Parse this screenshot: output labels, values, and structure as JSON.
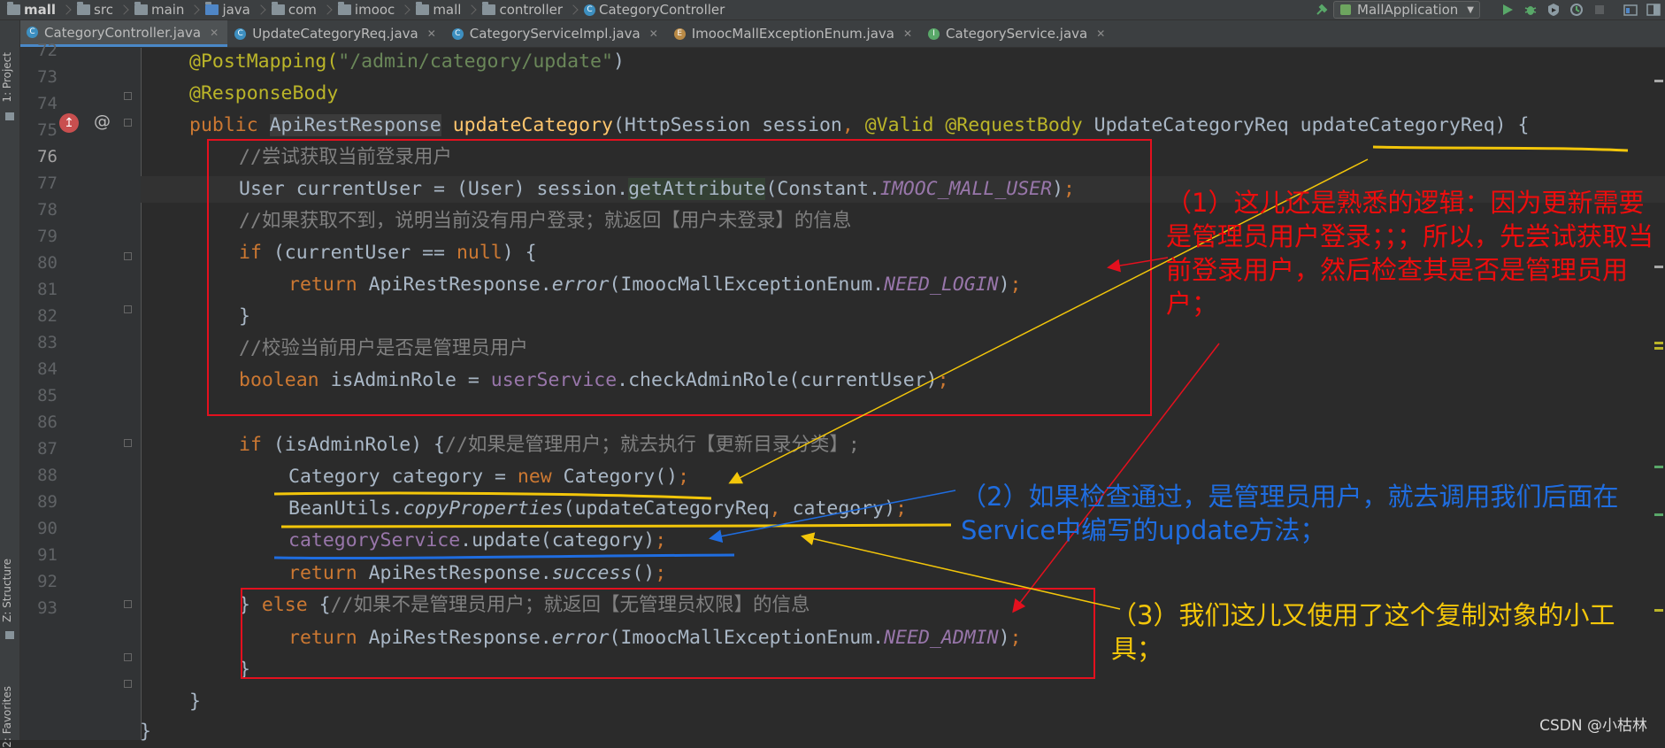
{
  "breadcrumb": [
    "mall",
    "src",
    "main",
    "java",
    "com",
    "imooc",
    "mall",
    "controller",
    "CategoryController"
  ],
  "run_config": "MallApplication",
  "tabs": [
    {
      "label": "CategoryController.java",
      "icon": "C",
      "active": true
    },
    {
      "label": "UpdateCategoryReq.java",
      "icon": "C"
    },
    {
      "label": "CategoryServiceImpl.java",
      "icon": "C"
    },
    {
      "label": "ImoocMallExceptionEnum.java",
      "icon": "E"
    },
    {
      "label": "CategoryService.java",
      "icon": "I"
    }
  ],
  "side_tabs": {
    "project": "1: Project",
    "structure": "Z: Structure",
    "favorites": "2: Favorites"
  },
  "gutter": {
    "current_line": 76,
    "lines": [
      72,
      73,
      74,
      75,
      76,
      77,
      78,
      79,
      80,
      81,
      82,
      83,
      84,
      85,
      86,
      87,
      88,
      89,
      90,
      91,
      92,
      93
    ],
    "icons": {
      "override": "↥",
      "at": "@"
    }
  },
  "code": {
    "l72": {
      "ann": "@PostMapping(",
      "str": "\"/admin/category/update\"",
      "close": ")"
    },
    "l73": {
      "ann": "@ResponseBody"
    },
    "l74": {
      "kw": "public ",
      "type": "ApiRestResponse",
      "fn": "updateCategory",
      "p1": "(HttpSession session",
      "c1": ", ",
      "a1": "@Valid ",
      "a2": "@RequestBody ",
      "p2": "UpdateCategoryReq updateCategoryReq) {"
    },
    "l75": {
      "cm": "//尝试获取当前登录用户"
    },
    "l76": {
      "t1": "User currentUser = (User) session.",
      "call": "getAttribute",
      "t2": "(Constant.",
      "fld": "IMOOC_MALL_USER",
      "t3": ")",
      "semi": ";"
    },
    "l77": {
      "cm": "//如果获取不到，说明当前没有用户登录；就返回【用户未登录】的信息"
    },
    "l78": {
      "kw": "if ",
      "t1": "(currentUser == ",
      "kw2": "null",
      "t2": ") {"
    },
    "l79": {
      "kw": "return ",
      "t1": "ApiRestResponse.",
      "m": "error",
      "t2": "(ImoocMallExceptionEnum.",
      "fld": "NEED_LOGIN",
      "t3": ")",
      "semi": ";"
    },
    "l80": {
      "t": "}"
    },
    "l81": {
      "cm": "//校验当前用户是否是管理员用户"
    },
    "l82": {
      "kw": "boolean ",
      "t1": "isAdminRole = ",
      "fld": "userService",
      "t2": ".checkAdminRole(currentUser)",
      "semi": ";"
    },
    "l84": {
      "kw": "if ",
      "t1": "(isAdminRole) {",
      "cm": "//如果是管理用户；就去执行【更新目录分类】;"
    },
    "l85": {
      "t1": "Category category = ",
      "kw": "new ",
      "t2": "Category()",
      "semi": ";"
    },
    "l86": {
      "t1": "BeanUtils.",
      "m": "copyProperties",
      "t2": "(updateCategoryReq",
      "c": ", ",
      "t3": "category)",
      "semi": ";"
    },
    "l87": {
      "fld": "categoryService",
      "t1": ".update(category)",
      "semi": ";"
    },
    "l88": {
      "kw": "return ",
      "t1": "ApiRestResponse.",
      "m": "success",
      "t2": "()",
      "semi": ";"
    },
    "l89": {
      "t1": "} ",
      "kw": "else ",
      "t2": "{",
      "cm": "//如果不是管理员用户；就返回【无管理员权限】的信息"
    },
    "l90": {
      "kw": "return ",
      "t1": "ApiRestResponse.",
      "m": "error",
      "t2": "(ImoocMallExceptionEnum.",
      "fld": "NEED_ADMIN",
      "t3": ")",
      "semi": ";"
    },
    "l91": {
      "t": "}"
    },
    "l92": {
      "t": "}"
    },
    "l93": {
      "t": "}"
    }
  },
  "annotations": {
    "red": "（1）这儿还是熟悉的逻辑：因为更新需要是管理员用户登录；；；所以，先尝试获取当前登录用户，然后检查其是否是管理员用户；",
    "blue": "（2）如果检查通过，是管理员用户，就去调用我们后面在Service中编写的update方法；",
    "yellow": "（3）我们这儿又使用了这个复制对象的小工具；"
  },
  "watermark": "CSDN @小枯林",
  "colors": {
    "background": "#2b2b2b",
    "keyword": "#cc7832",
    "annotation": "#bbb529",
    "string": "#6a8759",
    "comment": "#808080",
    "method": "#ffc66d",
    "field": "#9876aa",
    "red_mark": "#e4101e",
    "blue_mark": "#1f6de0",
    "yellow_mark": "#f3c60a"
  }
}
